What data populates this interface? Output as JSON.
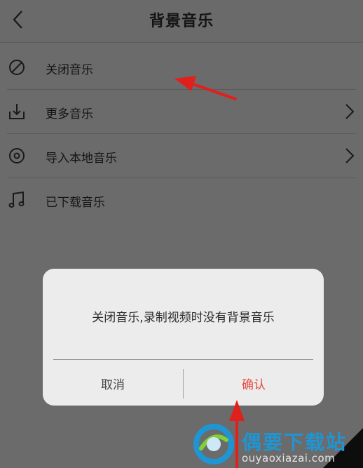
{
  "header": {
    "title": "背景音乐",
    "back_icon": "back-arrow-icon"
  },
  "list": {
    "items": [
      {
        "label": "关闭音乐",
        "icon": "no-music-icon",
        "has_chevron": false
      },
      {
        "label": "更多音乐",
        "icon": "download-icon",
        "has_chevron": true
      },
      {
        "label": "导入本地音乐",
        "icon": "disc-icon",
        "has_chevron": true
      },
      {
        "label": "已下载音乐",
        "icon": "music-note-icon",
        "has_chevron": false
      }
    ]
  },
  "dialog": {
    "message": "关闭音乐,录制视频时没有背景音乐",
    "cancel_label": "取消",
    "confirm_label": "确认"
  },
  "colors": {
    "overlay": "#6a6a6a",
    "confirm": "#e8483c",
    "arrow": "#e0201c",
    "watermark_blue": "#1f95d3"
  },
  "watermark": {
    "title": "偶要下载站",
    "url": "ouyaoxiazai.com"
  }
}
